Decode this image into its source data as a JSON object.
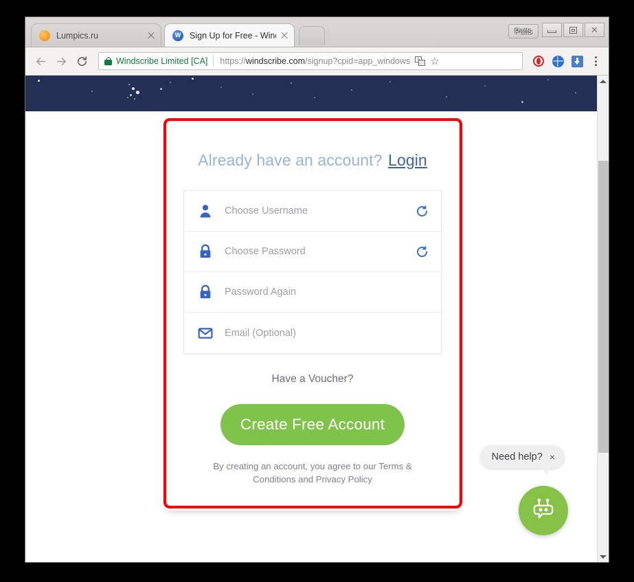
{
  "window": {
    "profile_label": "Patts",
    "controls": {
      "minimize": "minimize",
      "maximize": "maximize",
      "close": "close"
    }
  },
  "tabs": [
    {
      "title": "Lumpics.ru",
      "favicon": "orange-circle-icon",
      "active": false,
      "close_label": "×"
    },
    {
      "title": "Sign Up for Free - Winds",
      "favicon": "windscribe-w-icon",
      "active": true,
      "close_label": "×"
    }
  ],
  "toolbar": {
    "back": "back-arrow-icon",
    "forward": "forward-arrow-icon",
    "reload": "reload-icon",
    "site_identity": "Windscribe Limited [CA]",
    "url_scheme": "https://",
    "url_host": "windscribe.com",
    "url_path": "/signup?cpid=app_windows",
    "url_full": "https://windscribe.com/signup?cpid=app_windows",
    "translate": "translate-icon",
    "bookmark": "☆",
    "extensions": [
      "opera-vpn-icon",
      "globe-icon",
      "download-icon"
    ],
    "menu": "three-dots-menu-icon"
  },
  "page": {
    "banner": {
      "name": "starfield-hero-banner",
      "color": "#242f55"
    },
    "signup": {
      "already_text": "Already have an account?",
      "login_label": "Login",
      "fields": [
        {
          "icon": "user-icon",
          "placeholder": "Choose Username",
          "value": "",
          "has_refresh": true,
          "refresh_icon": "refresh-icon"
        },
        {
          "icon": "lock-icon",
          "placeholder": "Choose Password",
          "value": "",
          "has_refresh": true,
          "refresh_icon": "refresh-icon"
        },
        {
          "icon": "lock-icon",
          "placeholder": "Password Again",
          "value": "",
          "has_refresh": false,
          "refresh_icon": ""
        },
        {
          "icon": "envelope-icon",
          "placeholder": "Email (Optional)",
          "value": "",
          "has_refresh": false,
          "refresh_icon": ""
        }
      ],
      "voucher_label": "Have a Voucher?",
      "submit_label": "Create Free Account",
      "submit_color": "#80c34a",
      "terms_text": "By creating an account, you agree to our Terms & Conditions and Privacy Policy"
    },
    "chat": {
      "bubble_text": "Need help?",
      "bubble_close": "×",
      "launcher_icon": "robot-chat-icon",
      "launcher_color": "#85c247"
    }
  },
  "annotation": {
    "name": "red-highlight-box",
    "color": "#fb0000"
  },
  "scrollbar": {
    "up_arrow": "scroll-up-arrow-icon",
    "down_arrow": "scroll-down-arrow-icon",
    "thumb": "scroll-thumb"
  }
}
